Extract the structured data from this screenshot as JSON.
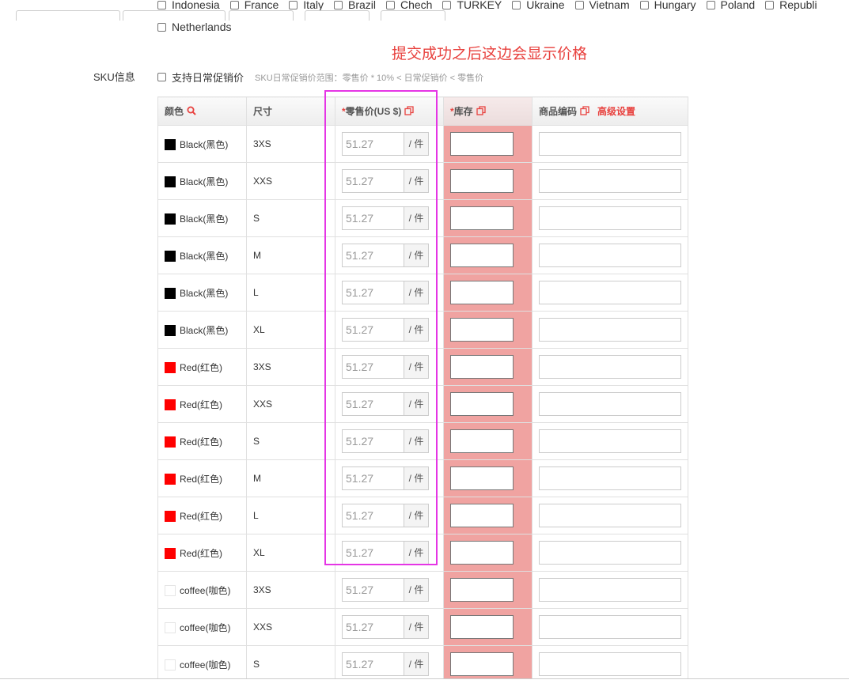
{
  "countries_row1": [
    "Indonesia",
    "France",
    "Italy",
    "Brazil",
    "Chech",
    "TURKEY",
    "Ukraine",
    "Vietnam",
    "Hungary",
    "Poland",
    "Republi"
  ],
  "countries_row2": [
    "Netherlands"
  ],
  "annotation": "提交成功之后这边会显示价格",
  "sku_label": "SKU信息",
  "promo": {
    "checkbox_label": "支持日常促销价",
    "hint": "SKU日常促销价范围：零售价 * 10% < 日常促销价 < 零售价"
  },
  "table": {
    "headers": {
      "color": "颜色",
      "size": "尺寸",
      "price_req": "*",
      "price": "零售价(US $)",
      "stock_req": "*",
      "stock": "库存",
      "code": "商品编码",
      "advanced": "高级设置"
    },
    "rows": [
      {
        "color": "Black(黑色)",
        "swatch": "#000000",
        "size": "3XS",
        "price": "51.27",
        "unit": "/ 件"
      },
      {
        "color": "Black(黑色)",
        "swatch": "#000000",
        "size": "XXS",
        "price": "51.27",
        "unit": "/ 件"
      },
      {
        "color": "Black(黑色)",
        "swatch": "#000000",
        "size": "S",
        "price": "51.27",
        "unit": "/ 件"
      },
      {
        "color": "Black(黑色)",
        "swatch": "#000000",
        "size": "M",
        "price": "51.27",
        "unit": "/ 件"
      },
      {
        "color": "Black(黑色)",
        "swatch": "#000000",
        "size": "L",
        "price": "51.27",
        "unit": "/ 件"
      },
      {
        "color": "Black(黑色)",
        "swatch": "#000000",
        "size": "XL",
        "price": "51.27",
        "unit": "/ 件"
      },
      {
        "color": "Red(红色)",
        "swatch": "#ff0000",
        "size": "3XS",
        "price": "51.27",
        "unit": "/ 件"
      },
      {
        "color": "Red(红色)",
        "swatch": "#ff0000",
        "size": "XXS",
        "price": "51.27",
        "unit": "/ 件"
      },
      {
        "color": "Red(红色)",
        "swatch": "#ff0000",
        "size": "S",
        "price": "51.27",
        "unit": "/ 件"
      },
      {
        "color": "Red(红色)",
        "swatch": "#ff0000",
        "size": "M",
        "price": "51.27",
        "unit": "/ 件"
      },
      {
        "color": "Red(红色)",
        "swatch": "#ff0000",
        "size": "L",
        "price": "51.27",
        "unit": "/ 件"
      },
      {
        "color": "Red(红色)",
        "swatch": "#ff0000",
        "size": "XL",
        "price": "51.27",
        "unit": "/ 件"
      },
      {
        "color": "coffee(咖色)",
        "swatch": "#ffffff",
        "size": "3XS",
        "price": "51.27",
        "unit": "/ 件"
      },
      {
        "color": "coffee(咖色)",
        "swatch": "#ffffff",
        "size": "XXS",
        "price": "51.27",
        "unit": "/ 件"
      },
      {
        "color": "coffee(咖色)",
        "swatch": "#ffffff",
        "size": "S",
        "price": "51.27",
        "unit": "/ 件"
      }
    ]
  },
  "colors": {
    "accent": "#e8413e",
    "highlight": "#e535e5",
    "stock_column": "#f0a3a1"
  }
}
